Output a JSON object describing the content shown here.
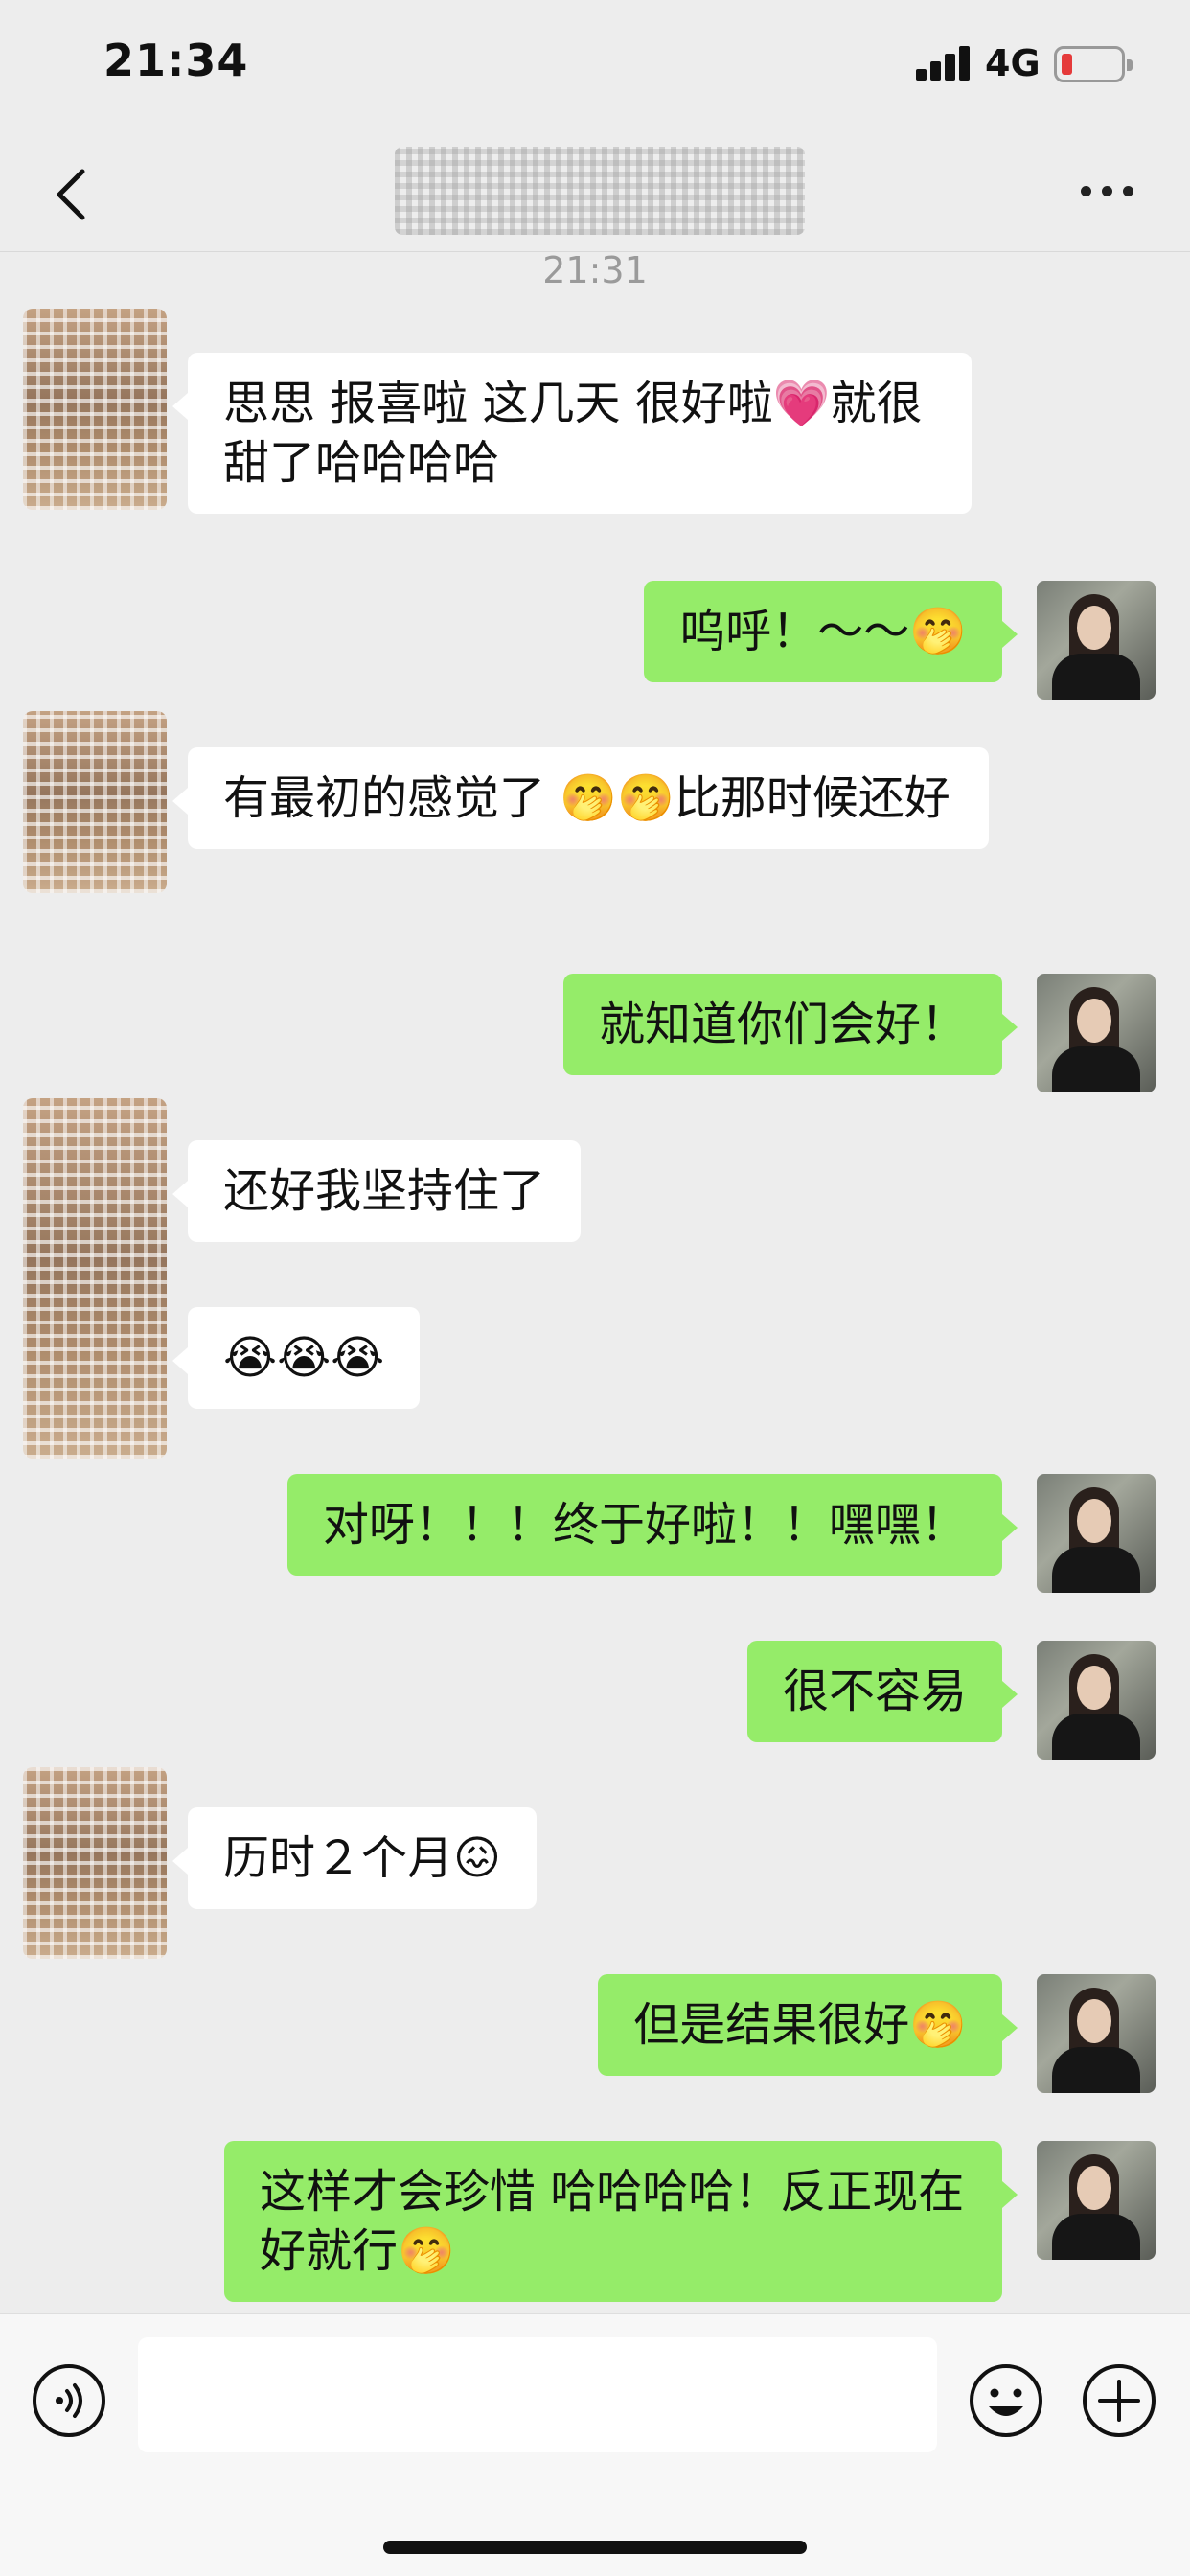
{
  "status_bar": {
    "time": "21:34",
    "network": "4G",
    "battery_color": "#e53a3a"
  },
  "header": {
    "back_icon": "chevron-left-icon",
    "more_icon": "more-dots-icon"
  },
  "timestamp": "21:31",
  "messages": [
    {
      "side": "in",
      "text": "思思 报喜啦 这几天 很好啦💗就很甜了哈哈哈哈"
    },
    {
      "side": "out",
      "text": "呜呼！～～🤭"
    },
    {
      "side": "in",
      "text": "有最初的感觉了 🤭🤭比那时候还好"
    },
    {
      "side": "out",
      "text": "就知道你们会好！"
    },
    {
      "side": "in",
      "text": "还好我坚持住了"
    },
    {
      "side": "in",
      "text": "😭😭😭"
    },
    {
      "side": "out",
      "text": "对呀！！！终于好啦！！嘿嘿！"
    },
    {
      "side": "out",
      "text": "很不容易"
    },
    {
      "side": "in",
      "text": "历时２个月😖"
    },
    {
      "side": "out",
      "text": "但是结果很好🤭"
    },
    {
      "side": "out",
      "text": "这样才会珍惜 哈哈哈哈！反正现在好就行🤭"
    }
  ],
  "input_bar": {
    "voice_icon": "voice-icon",
    "input_value": "",
    "emoji_icon": "emoji-icon",
    "plus_icon": "plus-icon"
  },
  "colors": {
    "outgoing_bubble": "#95ec69",
    "incoming_bubble": "#ffffff",
    "background": "#ededed"
  }
}
